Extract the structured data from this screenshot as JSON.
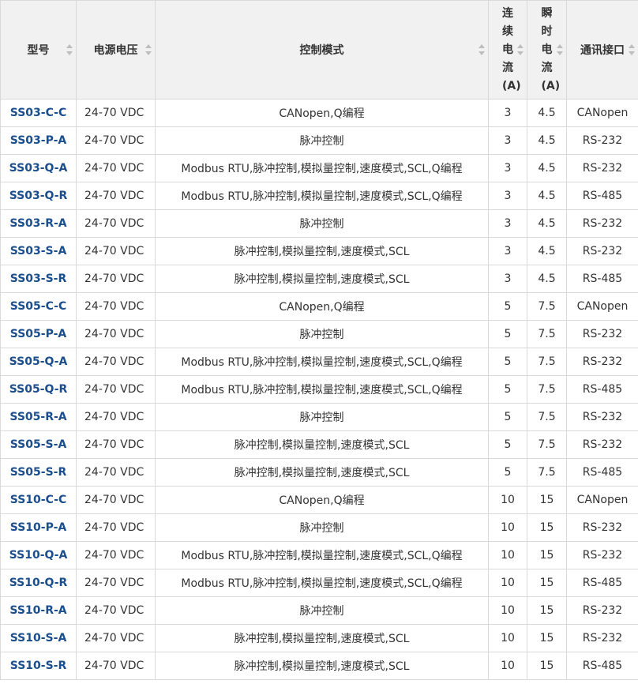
{
  "table": {
    "headers": {
      "model": "型号",
      "voltage": "电源电压",
      "mode": "控制模式",
      "cont_current": "连续电流(A)",
      "peak_current": "瞬时电流(A)",
      "comm": "通讯接口"
    },
    "rows": [
      {
        "model": "SS03-C-C",
        "voltage": "24-70 VDC",
        "mode": "CANopen,Q编程",
        "cont": "3",
        "peak": "4.5",
        "comm": "CANopen"
      },
      {
        "model": "SS03-P-A",
        "voltage": "24-70 VDC",
        "mode": "脉冲控制",
        "cont": "3",
        "peak": "4.5",
        "comm": "RS-232"
      },
      {
        "model": "SS03-Q-A",
        "voltage": "24-70 VDC",
        "mode": "Modbus RTU,脉冲控制,模拟量控制,速度模式,SCL,Q编程",
        "cont": "3",
        "peak": "4.5",
        "comm": "RS-232"
      },
      {
        "model": "SS03-Q-R",
        "voltage": "24-70 VDC",
        "mode": "Modbus RTU,脉冲控制,模拟量控制,速度模式,SCL,Q编程",
        "cont": "3",
        "peak": "4.5",
        "comm": "RS-485"
      },
      {
        "model": "SS03-R-A",
        "voltage": "24-70 VDC",
        "mode": "脉冲控制",
        "cont": "3",
        "peak": "4.5",
        "comm": "RS-232"
      },
      {
        "model": "SS03-S-A",
        "voltage": "24-70 VDC",
        "mode": "脉冲控制,模拟量控制,速度模式,SCL",
        "cont": "3",
        "peak": "4.5",
        "comm": "RS-232"
      },
      {
        "model": "SS03-S-R",
        "voltage": "24-70 VDC",
        "mode": "脉冲控制,模拟量控制,速度模式,SCL",
        "cont": "3",
        "peak": "4.5",
        "comm": "RS-485"
      },
      {
        "model": "SS05-C-C",
        "voltage": "24-70 VDC",
        "mode": "CANopen,Q编程",
        "cont": "5",
        "peak": "7.5",
        "comm": "CANopen"
      },
      {
        "model": "SS05-P-A",
        "voltage": "24-70 VDC",
        "mode": "脉冲控制",
        "cont": "5",
        "peak": "7.5",
        "comm": "RS-232"
      },
      {
        "model": "SS05-Q-A",
        "voltage": "24-70 VDC",
        "mode": "Modbus RTU,脉冲控制,模拟量控制,速度模式,SCL,Q编程",
        "cont": "5",
        "peak": "7.5",
        "comm": "RS-232"
      },
      {
        "model": "SS05-Q-R",
        "voltage": "24-70 VDC",
        "mode": "Modbus RTU,脉冲控制,模拟量控制,速度模式,SCL,Q编程",
        "cont": "5",
        "peak": "7.5",
        "comm": "RS-485"
      },
      {
        "model": "SS05-R-A",
        "voltage": "24-70 VDC",
        "mode": "脉冲控制",
        "cont": "5",
        "peak": "7.5",
        "comm": "RS-232"
      },
      {
        "model": "SS05-S-A",
        "voltage": "24-70 VDC",
        "mode": "脉冲控制,模拟量控制,速度模式,SCL",
        "cont": "5",
        "peak": "7.5",
        "comm": "RS-232"
      },
      {
        "model": "SS05-S-R",
        "voltage": "24-70 VDC",
        "mode": "脉冲控制,模拟量控制,速度模式,SCL",
        "cont": "5",
        "peak": "7.5",
        "comm": "RS-485"
      },
      {
        "model": "SS10-C-C",
        "voltage": "24-70 VDC",
        "mode": "CANopen,Q编程",
        "cont": "10",
        "peak": "15",
        "comm": "CANopen"
      },
      {
        "model": "SS10-P-A",
        "voltage": "24-70 VDC",
        "mode": "脉冲控制",
        "cont": "10",
        "peak": "15",
        "comm": "RS-232"
      },
      {
        "model": "SS10-Q-A",
        "voltage": "24-70 VDC",
        "mode": "Modbus RTU,脉冲控制,模拟量控制,速度模式,SCL,Q编程",
        "cont": "10",
        "peak": "15",
        "comm": "RS-232"
      },
      {
        "model": "SS10-Q-R",
        "voltage": "24-70 VDC",
        "mode": "Modbus RTU,脉冲控制,模拟量控制,速度模式,SCL,Q编程",
        "cont": "10",
        "peak": "15",
        "comm": "RS-485"
      },
      {
        "model": "SS10-R-A",
        "voltage": "24-70 VDC",
        "mode": "脉冲控制",
        "cont": "10",
        "peak": "15",
        "comm": "RS-232"
      },
      {
        "model": "SS10-S-A",
        "voltage": "24-70 VDC",
        "mode": "脉冲控制,模拟量控制,速度模式,SCL",
        "cont": "10",
        "peak": "15",
        "comm": "RS-232"
      },
      {
        "model": "SS10-S-R",
        "voltage": "24-70 VDC",
        "mode": "脉冲控制,模拟量控制,速度模式,SCL",
        "cont": "10",
        "peak": "15",
        "comm": "RS-485"
      }
    ]
  },
  "colors": {
    "model_link": "#1b4e8c",
    "header_bg": "#f1f1f1",
    "border": "#d9d9d9",
    "text": "#333333"
  },
  "icons": {
    "sort": "sort-arrows-icon"
  }
}
